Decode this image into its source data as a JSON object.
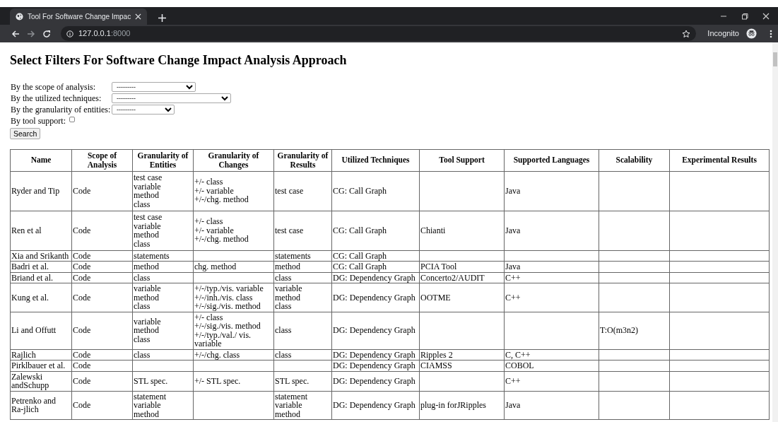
{
  "browser": {
    "tab_title": "Tool For Software Change Impac",
    "url_host": "127.0.0.1",
    "url_port": ":8000",
    "profile": "Incognito"
  },
  "page": {
    "heading": "Select Filters For Software Change Impact Analysis Approach",
    "filters": [
      {
        "kind": "select",
        "label": "By the scope of analysis:",
        "value": "---------"
      },
      {
        "kind": "select",
        "label": "By the utilized techniques:",
        "value": "---------"
      },
      {
        "kind": "select",
        "label": "By the granularity of entities:",
        "value": "---------"
      },
      {
        "kind": "checkbox",
        "label": "By tool support:",
        "checked": false
      }
    ],
    "search_button": "Search"
  },
  "table": {
    "columns": [
      "Name",
      "Scope of Analysis",
      "Granularity of Entities",
      "Granularity of Changes",
      "Granularity of Results",
      "Utilized Techniques",
      "Tool Support",
      "Supported Languages",
      "Scalability",
      "Experimental Results"
    ],
    "rows": [
      [
        "Ryder and Tip",
        "Code",
        "test case\nvariable\nmethod\nclass",
        "+/- class\n+/- variable\n+/-/chg. method",
        "test case",
        "CG: Call Graph",
        "",
        "Java",
        "",
        ""
      ],
      [
        "Ren et al",
        "Code",
        "test case\nvariable\nmethod\nclass",
        "+/- class\n+/- variable\n+/-/chg. method",
        "test case",
        "CG: Call Graph",
        "Chianti",
        "Java",
        "",
        ""
      ],
      [
        "Xia and Srikanth",
        "Code",
        "statements",
        "",
        "statements",
        "CG: Call Graph",
        "",
        "",
        "",
        ""
      ],
      [
        "Badri et al.",
        "Code",
        "method",
        "chg. method",
        "method",
        "CG: Call Graph",
        "PCIA Tool",
        "Java",
        "",
        ""
      ],
      [
        "Briand et al.",
        "Code",
        "class",
        "",
        "class",
        "DG: Dependency Graph",
        "Concerto2/AUDIT",
        "C++",
        "",
        ""
      ],
      [
        "Kung et al.",
        "Code",
        "variable\nmethod\nclass",
        "+/-/typ./vis. variable\n+/-/inh./vis. class\n+/-/sig./vis. method",
        "variable\nmethod\nclass",
        "DG: Dependency Graph",
        "OOTME",
        "C++",
        "",
        ""
      ],
      [
        "Li and Offutt",
        "Code",
        "variable\nmethod\nclass",
        "+/- class\n+/-/sig./vis. method\n+/-/typ./val./ vis. variable",
        "class",
        "DG: Dependency Graph",
        "",
        "",
        "T:O(m3n2)",
        ""
      ],
      [
        "Rajlich",
        "Code",
        "class",
        "+/-/chg. class",
        "class",
        "DG: Dependency Graph",
        "Ripples 2",
        "C, C++",
        "",
        ""
      ],
      [
        "Pirklbauer et al.",
        "Code",
        "",
        "",
        "",
        "DG: Dependency Graph",
        "CIAMSS",
        "COBOL",
        "",
        ""
      ],
      [
        "Zalewski andSchupp",
        "Code",
        "STL spec.",
        "+/- STL spec.",
        "STL spec.",
        "DG: Dependency Graph",
        "",
        "C++",
        "",
        ""
      ],
      [
        "Petrenko and Ra-jlich",
        "Code",
        "statement\nvariable\nmethod",
        "",
        "statement\nvariable\nmethod",
        "DG: Dependency Graph",
        "plug-in forJRipples",
        "Java",
        "",
        ""
      ]
    ]
  }
}
